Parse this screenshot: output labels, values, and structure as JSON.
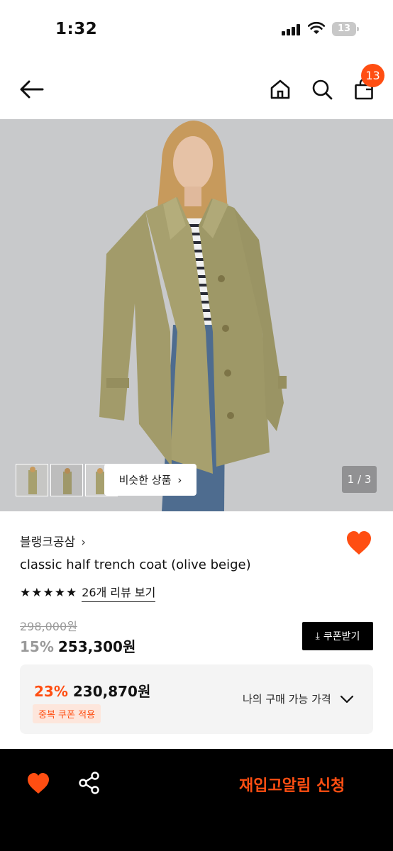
{
  "status_bar": {
    "time": "1:32",
    "battery": "13"
  },
  "nav": {
    "cart_count": "13"
  },
  "gallery": {
    "similar_label": "비슷한 상품",
    "chevron": "›",
    "pager": "1 / 3"
  },
  "product": {
    "brand": "블랭크공삼",
    "brand_chevron": "›",
    "name": "classic half trench coat (olive beige)",
    "stars": "★★★★★",
    "review_link": "26개 리뷰 보기",
    "original_price": "298,000원",
    "discount_pct": "15%",
    "sale_price": "253,300원",
    "coupon_button": "쿠폰받기",
    "coupon_icon": "⤓"
  },
  "benefit": {
    "pct": "23%",
    "price": "230,870원",
    "badge": "중복 쿠폰 적용",
    "my_price_label": "나의 구매 가능 가격"
  },
  "bottom_bar": {
    "restock_label": "재입고알림 신청"
  },
  "colors": {
    "accent": "#ff4e12",
    "bar": "#000000"
  },
  "icons": [
    "back-arrow-icon",
    "home-icon",
    "search-icon",
    "shopping-bag-icon",
    "heart-icon",
    "share-icon",
    "chevron-down-icon",
    "download-icon"
  ]
}
